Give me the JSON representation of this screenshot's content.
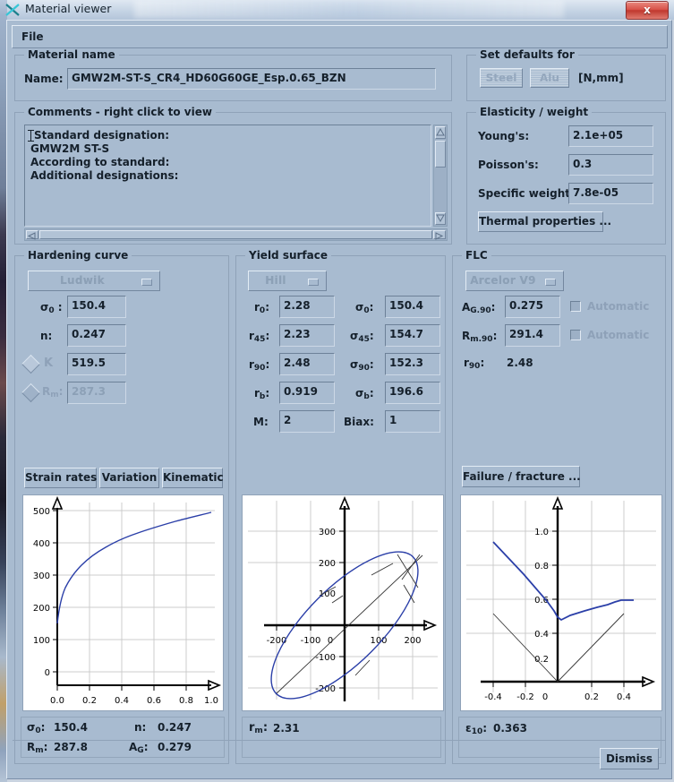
{
  "window": {
    "title": "Material viewer",
    "icon": "x-scissors-icon",
    "close_label": "x"
  },
  "menubar": {
    "items": [
      "File"
    ]
  },
  "material_name": {
    "legend": "Material name",
    "name_label": "Name:",
    "name_value": "GMW2M-ST-S_CR4_HD60G60GE_Esp.0.65_BZN"
  },
  "comments": {
    "legend": "Comments - right click to view",
    "lines": [
      "Standard designation:",
      "  GMW2M ST-S",
      " According to standard:",
      "",
      " Additional designations:"
    ]
  },
  "set_defaults": {
    "legend": "Set defaults for",
    "steel_button": "Steel",
    "alu_button": "Alu",
    "units": "[N,mm]"
  },
  "elasticity": {
    "legend": "Elasticity / weight",
    "youngs_label": "Young's:",
    "youngs_value": "2.1e+05",
    "poissons_label": "Poisson's:",
    "poissons_value": "0.3",
    "specific_weight_label": "Specific weight:",
    "specific_weight_value": "7.8e-05",
    "thermal_button": "Thermal properties ..."
  },
  "hardening": {
    "legend": "Hardening curve",
    "model": "Ludwik",
    "fields": [
      {
        "label": "σ",
        "sub": "0",
        "colon": ":",
        "value": "150.4"
      },
      {
        "label": "n",
        "sub": "",
        "colon": ":",
        "value": "0.247"
      }
    ],
    "radio_k": {
      "label": "K",
      "value": "519.5",
      "selected": true
    },
    "radio_rm": {
      "label": "R",
      "sub": "m",
      "colon": ":",
      "value": "287.3",
      "selected": false
    },
    "buttons": [
      "Strain rates",
      "Variation",
      "Kinematic"
    ],
    "summary": [
      {
        "label": "σ",
        "sub": "0",
        "value": "150.4"
      },
      {
        "label": "n",
        "sub": "",
        "value": "0.247"
      },
      {
        "label": "R",
        "sub": "m",
        "value": "287.8"
      },
      {
        "label": "A",
        "sub": "G",
        "value": "0.279"
      }
    ]
  },
  "yield_surface": {
    "legend": "Yield surface",
    "model": "Hill",
    "left_fields": [
      {
        "label": "r",
        "sub": "0",
        "value": "2.28"
      },
      {
        "label": "r",
        "sub": "45",
        "value": "2.23"
      },
      {
        "label": "r",
        "sub": "90",
        "value": "2.48"
      },
      {
        "label": "r",
        "sub": "b",
        "value": "0.919"
      },
      {
        "label": "M",
        "sub": "",
        "value": "2"
      }
    ],
    "right_fields": [
      {
        "label": "σ",
        "sub": "0",
        "value": "150.4"
      },
      {
        "label": "σ",
        "sub": "45",
        "value": "154.7"
      },
      {
        "label": "σ",
        "sub": "90",
        "value": "152.3"
      },
      {
        "label": "σ",
        "sub": "b",
        "value": "196.6"
      },
      {
        "label": "Biax",
        "sub": "",
        "value": "1"
      }
    ],
    "summary": {
      "label": "r",
      "sub": "m",
      "value": "2.31"
    }
  },
  "flc": {
    "legend": "FLC",
    "model": "Arcelor V9",
    "fields": [
      {
        "label": "A",
        "sub": "G.90",
        "value": "0.275",
        "checkbox": "Automatic",
        "checked": false
      },
      {
        "label": "R",
        "sub": "m.90",
        "value": "291.4",
        "checkbox": "Automatic",
        "checked": false
      }
    ],
    "readonly": {
      "label": "r",
      "sub": "90",
      "value": "2.48"
    },
    "failure_button": "Failure / fracture ...",
    "summary": {
      "label": "ε",
      "sub": "10",
      "value": "0.363"
    }
  },
  "dismiss_button": "Dismiss",
  "colors": {
    "dialog_bg": "#a8bbd0",
    "curve": "#2b3fa8",
    "plot_bg": "#ffffff",
    "grid": "#c8c8c8",
    "axis": "#000000",
    "close_red": "#c0392f"
  },
  "chart_data": [
    {
      "type": "line",
      "title": "Hardening curve",
      "xlabel": "",
      "ylabel": "",
      "xlim": [
        -0.07,
        1.12
      ],
      "ylim": [
        -55,
        575
      ],
      "xticks": [
        "0.0",
        "0.2",
        "0.4",
        "0.6",
        "0.8",
        "1.0"
      ],
      "xtick_values": [
        0.0,
        0.2,
        0.4,
        0.6,
        0.8,
        1.0
      ],
      "yticks": [
        "0",
        "100",
        "200",
        "300",
        "400",
        "500"
      ],
      "ytick_values": [
        0,
        100,
        200,
        300,
        400,
        500
      ],
      "grid": true,
      "legend": "none",
      "series": [
        {
          "name": "Ludwik sigma(eps)",
          "x": [
            0.0,
            0.005,
            0.01,
            0.02,
            0.04,
            0.06,
            0.08,
            0.1,
            0.15,
            0.2,
            0.25,
            0.3,
            0.35,
            0.4,
            0.5,
            0.6,
            0.7,
            0.8,
            0.9,
            1.0
          ],
          "y": [
            150.4,
            200,
            222,
            250,
            280,
            300,
            316,
            330,
            357,
            378,
            395,
            409,
            421,
            432,
            451,
            467,
            481,
            493,
            504,
            519
          ]
        }
      ]
    },
    {
      "type": "line",
      "title": "Yield surface (Hill)",
      "xlabel": "",
      "ylabel": "",
      "xlim": [
        -290,
        290
      ],
      "ylim": [
        -290,
        390
      ],
      "xticks": [
        "-200",
        "-100",
        "0",
        "100",
        "200"
      ],
      "xtick_values": [
        -200,
        -100,
        0,
        100,
        200
      ],
      "yticks": [
        "-200",
        "-100",
        "100",
        "200",
        "300"
      ],
      "ytick_values": [
        -200,
        -100,
        100,
        200,
        300
      ],
      "grid": true,
      "legend": "none",
      "series": [
        {
          "name": "yield-locus-ellipse",
          "description": "tilted ellipse, semi-major ~285 along 45deg line, semi-minor ~112",
          "rotation_deg": 45,
          "semi_major": 285,
          "semi_minor": 112
        },
        {
          "name": "equibiaxial-diagonal",
          "x": [
            -240,
            230
          ],
          "y": [
            -240,
            230
          ]
        },
        {
          "name": "tangent-marks",
          "count": 4
        }
      ]
    },
    {
      "type": "line",
      "title": "FLC (Arcelor V9)",
      "xlabel": "",
      "ylabel": "",
      "xlim": [
        -0.52,
        0.55
      ],
      "ylim": [
        -0.16,
        1.17
      ],
      "xticks": [
        "-0.4",
        "-0.2",
        "0",
        "0.2",
        "0.4"
      ],
      "xtick_values": [
        -0.4,
        -0.2,
        0,
        0.2,
        0.4
      ],
      "yticks": [
        "0.2",
        "0.4",
        "0.6",
        "0.8",
        "1.0"
      ],
      "ytick_values": [
        0.2,
        0.4,
        0.6,
        0.8,
        1.0
      ],
      "grid": true,
      "legend": "none",
      "series": [
        {
          "name": "forming-limit-curve",
          "x": [
            -0.4,
            -0.3,
            -0.2,
            -0.1,
            -0.02,
            0.03,
            0.1,
            0.18,
            0.26,
            0.32,
            0.38,
            0.47
          ],
          "y": [
            0.83,
            0.71,
            0.59,
            0.47,
            0.385,
            0.363,
            0.395,
            0.42,
            0.44,
            0.462,
            0.466,
            0.466
          ]
        },
        {
          "name": "left-reference-line",
          "x": [
            -0.4,
            0.0
          ],
          "y": [
            0.4,
            0.0
          ]
        },
        {
          "name": "right-reference-line",
          "x": [
            0.0,
            0.4
          ],
          "y": [
            0.0,
            0.4
          ]
        }
      ]
    }
  ]
}
